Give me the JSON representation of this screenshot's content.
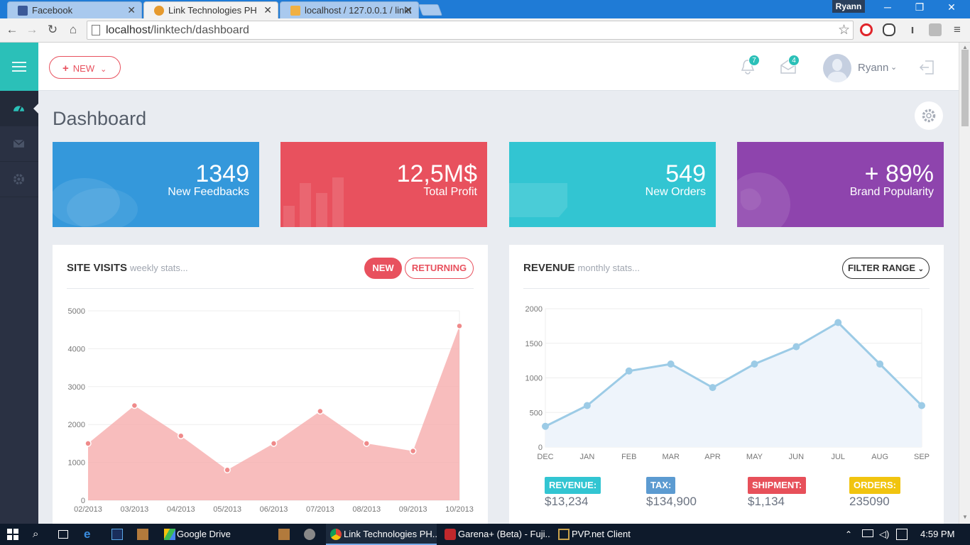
{
  "browser": {
    "tabs": [
      {
        "title": "Facebook",
        "active": false
      },
      {
        "title": "Link Technologies PH",
        "active": true
      },
      {
        "title": "localhost / 127.0.0.1 / linkt",
        "active": false
      }
    ],
    "profile_name": "Ryann",
    "url_host": "localhost",
    "url_path": "/linktech/dashboard"
  },
  "topbar": {
    "new_label": "NEW",
    "notifications_count": "7",
    "messages_count": "4",
    "user_name": "Ryann"
  },
  "page": {
    "title": "Dashboard"
  },
  "stats": [
    {
      "value": "1349",
      "label": "New Feedbacks",
      "color": "#3498db"
    },
    {
      "value": "12,5M$",
      "label": "Total Profit",
      "color": "#e8515e"
    },
    {
      "value": "549",
      "label": "New Orders",
      "color": "#32c5d2"
    },
    {
      "value": "+ 89%",
      "label": "Brand Popularity",
      "color": "#8e44ad"
    }
  ],
  "site_visits": {
    "title": "SITE VISITS",
    "subtitle": "weekly stats...",
    "new_label": "NEW",
    "returning_label": "RETURNING"
  },
  "revenue": {
    "title": "REVENUE",
    "subtitle": "monthly stats...",
    "filter_label": "FILTER RANGE",
    "legend": [
      {
        "label": "REVENUE:",
        "value": "$13,234",
        "color": "#32c5d2"
      },
      {
        "label": "TAX:",
        "value": "$134,900",
        "color": "#5c9bd1"
      },
      {
        "label": "SHIPMENT:",
        "value": "$1,134",
        "color": "#e7505a"
      },
      {
        "label": "ORDERS:",
        "value": "235090",
        "color": "#f1c40f"
      }
    ]
  },
  "chart_data": [
    {
      "type": "area",
      "categories": [
        "02/2013",
        "03/2013",
        "04/2013",
        "05/2013",
        "06/2013",
        "07/2013",
        "08/2013",
        "09/2013",
        "10/2013"
      ],
      "values": [
        1500,
        2500,
        1700,
        800,
        1500,
        2350,
        1500,
        1300,
        4600
      ],
      "yticks": [
        0,
        1000,
        2000,
        3000,
        4000,
        5000
      ],
      "ylim": [
        0,
        5000
      ],
      "color": "#f6a7a7"
    },
    {
      "type": "line",
      "categories": [
        "DEC",
        "JAN",
        "FEB",
        "MAR",
        "APR",
        "MAY",
        "JUN",
        "JUL",
        "AUG",
        "SEP"
      ],
      "values": [
        300,
        600,
        1100,
        1200,
        860,
        1200,
        1450,
        1800,
        1200,
        600
      ],
      "yticks": [
        0,
        500,
        1000,
        1500,
        2000
      ],
      "ylim": [
        0,
        2000
      ],
      "color": "#9ccbe6"
    }
  ],
  "taskbar": {
    "items": [
      "Google Drive",
      "Link Technologies PH...",
      "Garena+ (Beta) - Fuji...",
      "PVP.net Client"
    ],
    "clock": "4:59 PM"
  }
}
